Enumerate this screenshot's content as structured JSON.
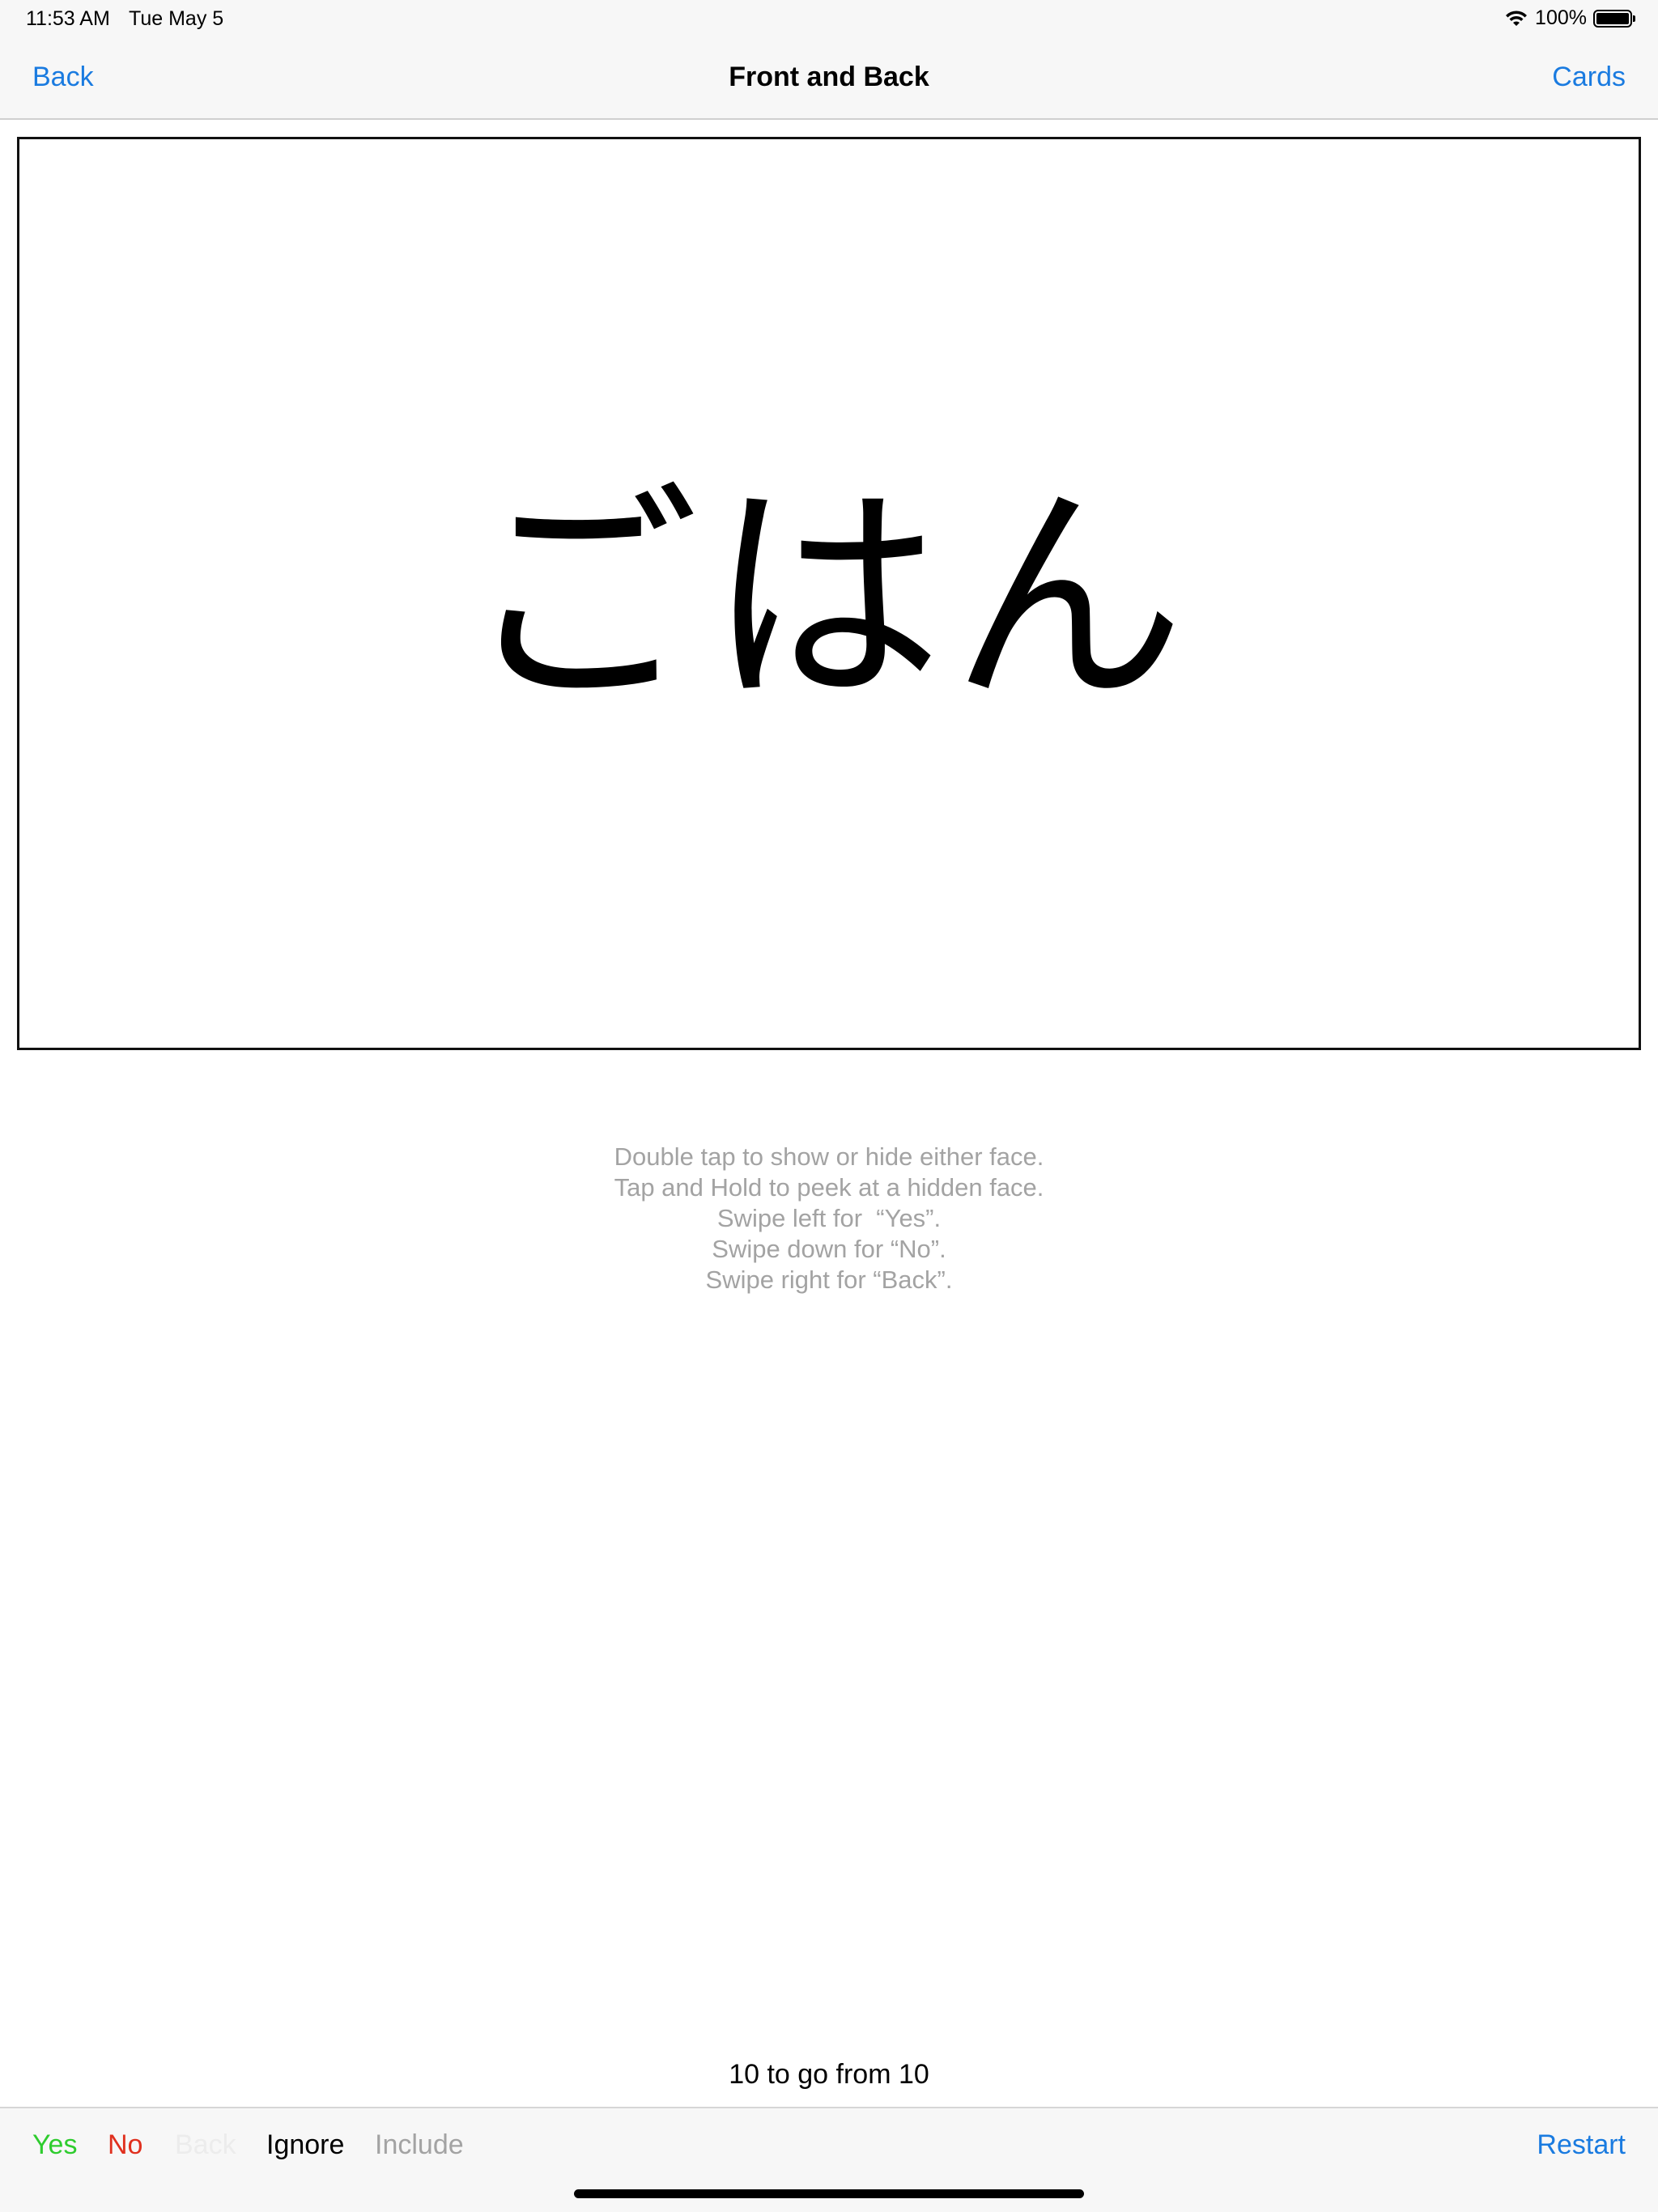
{
  "status_bar": {
    "time": "11:53 AM",
    "date": "Tue May 5",
    "battery_text": "100%",
    "battery_level": 1.0
  },
  "nav": {
    "back_label": "Back",
    "title": "Front and Back",
    "cards_label": "Cards"
  },
  "card": {
    "face_text": "ごはん"
  },
  "instructions": [
    "Double tap to show or hide either face.",
    "Tap and Hold to peek at a hidden face.",
    "Swipe left for  “Yes”.",
    "Swipe down for “No”.",
    "Swipe right for “Back”."
  ],
  "progress": "10 to go from 10",
  "toolbar": {
    "yes_label": "Yes",
    "no_label": "No",
    "back_label": "Back",
    "ignore_label": "Ignore",
    "include_label": "Include",
    "restart_label": "Restart"
  },
  "colors": {
    "accent": "#1a7be0",
    "yes": "#2ecc2e",
    "no": "#e0301e",
    "hint_text": "#a3a3a3"
  }
}
